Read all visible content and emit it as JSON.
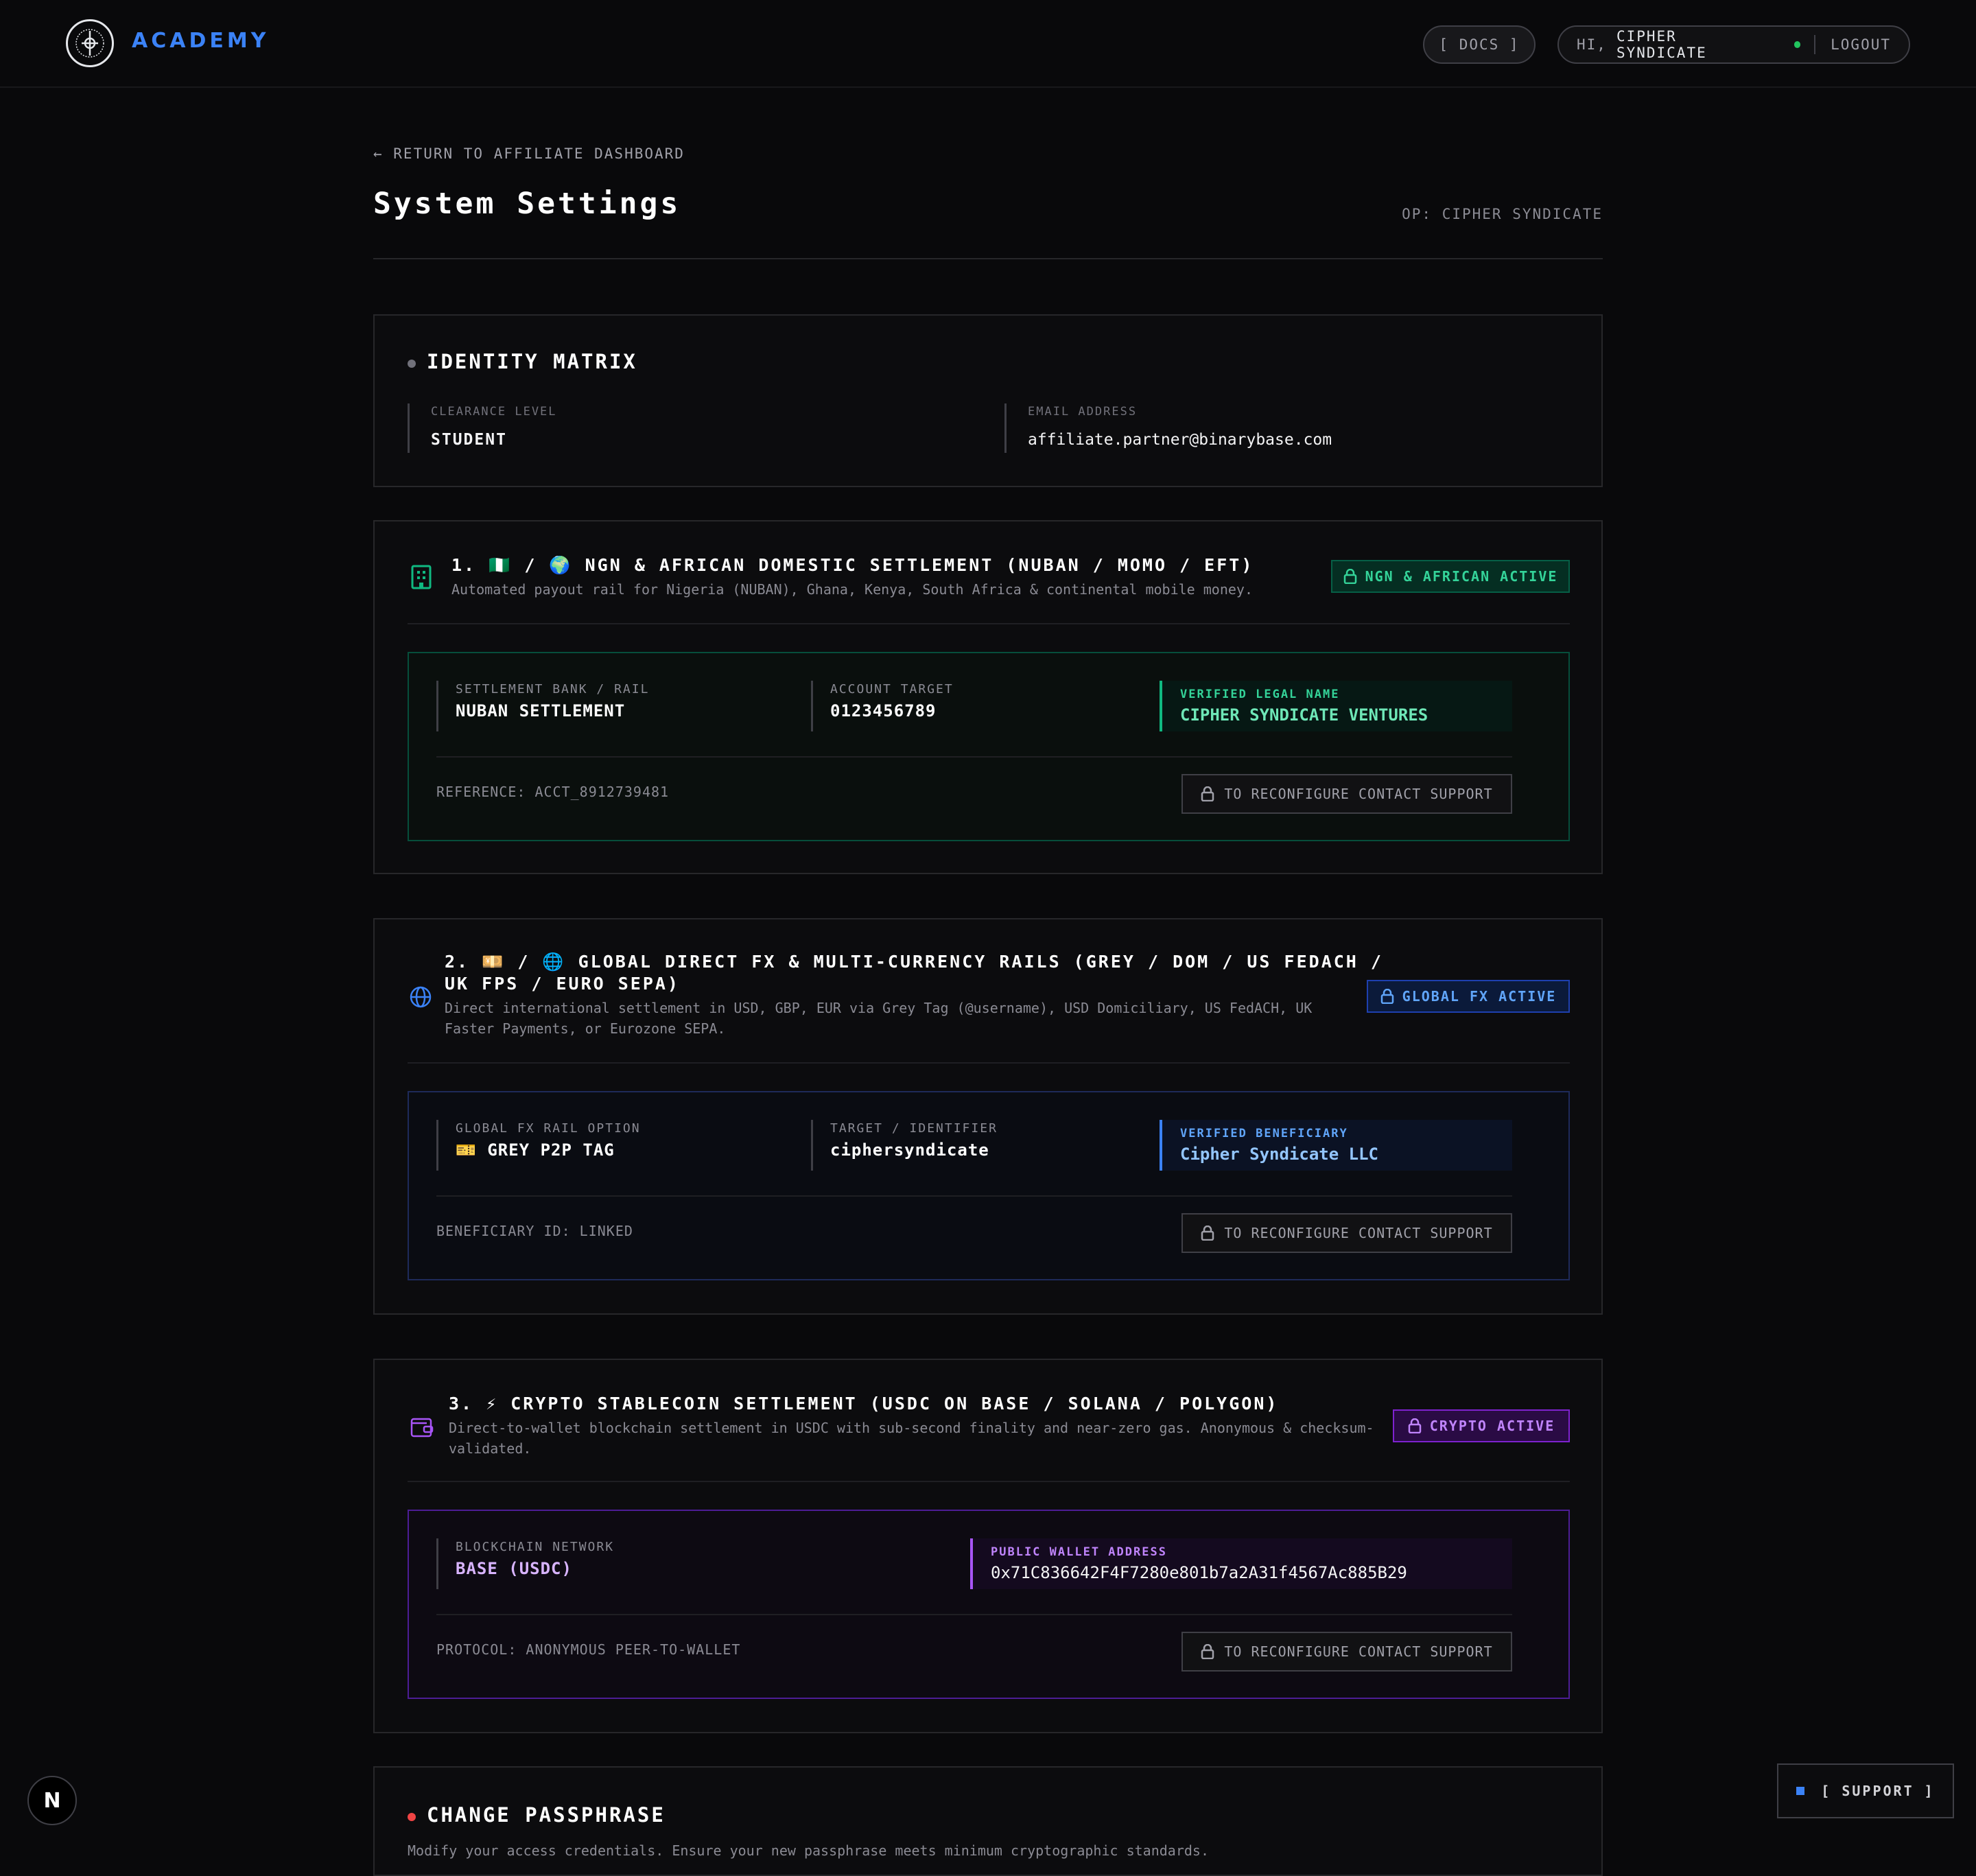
{
  "header": {
    "brand": "ACADEMY",
    "docs_label": "[ DOCS ]",
    "greeting": "HI,",
    "username": "CIPHER SYNDICATE",
    "logout_label": "LOGOUT"
  },
  "page": {
    "back_link": "← RETURN TO AFFILIATE DASHBOARD",
    "title": "System Settings",
    "operator": "OP: CIPHER SYNDICATE"
  },
  "identity": {
    "title": "IDENTITY MATRIX",
    "clearance_label": "CLEARANCE LEVEL",
    "clearance_value": "STUDENT",
    "email_label": "EMAIL ADDRESS",
    "email_value": "affiliate.partner@binarybase.com"
  },
  "rails": [
    {
      "title": "1. 🇳🇬 / 🌍 NGN & AFRICAN DOMESTIC SETTLEMENT (NUBAN / MOMO / EFT)",
      "description": "Automated payout rail for Nigeria (NUBAN), Ghana, Kenya, South Africa & continental mobile money.",
      "badge": "NGN & AFRICAN ACTIVE",
      "field1_label": "SETTLEMENT BANK / RAIL",
      "field1_value": "NUBAN SETTLEMENT",
      "field2_label": "ACCOUNT TARGET",
      "field2_value": "0123456789",
      "verified_label": "VERIFIED LEGAL NAME",
      "verified_value": "CIPHER SYNDICATE VENTURES",
      "footer_text": "REFERENCE: ACCT_8912739481",
      "reconfigure_label": "TO RECONFIGURE CONTACT SUPPORT",
      "accent": "#10b981"
    },
    {
      "title_line1": "2. 💴 / 🌐 GLOBAL DIRECT FX & MULTI-CURRENCY RAILS (GREY / DOM / US FEDACH /",
      "title_line2": "UK FPS / EURO SEPA)",
      "description_line1": "Direct international settlement in USD, GBP, EUR via Grey Tag (@username), USD Domiciliary, US FedACH, UK",
      "description_line2": "Faster Payments, or Eurozone SEPA.",
      "badge": "GLOBAL FX ACTIVE",
      "field1_label": "GLOBAL FX RAIL OPTION",
      "field1_value": "🎫 GREY P2P TAG",
      "field2_label": "TARGET / IDENTIFIER",
      "field2_value": "ciphersyndicate",
      "verified_label": "VERIFIED BENEFICIARY",
      "verified_value": "Cipher Syndicate LLC",
      "footer_text": "BENEFICIARY ID: LINKED",
      "reconfigure_label": "TO RECONFIGURE CONTACT SUPPORT",
      "accent": "#3b82f6"
    },
    {
      "title": "3. ⚡ CRYPTO STABLECOIN SETTLEMENT (USDC ON BASE / SOLANA / POLYGON)",
      "description_line1": "Direct-to-wallet blockchain settlement in USDC with sub-second finality and near-zero gas. Anonymous & checksum-",
      "description_line2": "validated.",
      "badge": "CRYPTO ACTIVE",
      "field1_label": "BLOCKCHAIN NETWORK",
      "field1_value": "BASE (USDC)",
      "verified_label": "PUBLIC WALLET ADDRESS",
      "verified_value": "0x71C836642F4F7280e801b7a2A31f4567Ac885B29",
      "footer_text": "PROTOCOL: ANONYMOUS PEER-TO-WALLET",
      "reconfigure_label": "TO RECONFIGURE CONTACT SUPPORT",
      "accent": "#a855f7"
    }
  ],
  "passphrase": {
    "title": "CHANGE PASSPHRASE",
    "description": "Modify your access credentials. Ensure your new passphrase meets minimum cryptographic standards."
  },
  "floating": {
    "n_label": "N",
    "support_label": "[ SUPPORT ]"
  }
}
